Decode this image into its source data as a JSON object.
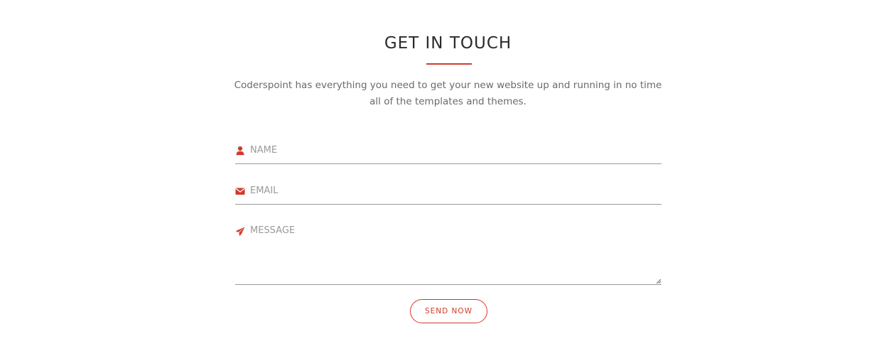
{
  "contact": {
    "title": "GET IN TOUCH",
    "intro": "Coderspoint has everything you need to get your new website up and running in no time all of the templates and themes.",
    "accent_color": "#d33a2c"
  },
  "form": {
    "name": {
      "placeholder": "NAME",
      "value": "",
      "icon": "user-icon"
    },
    "email": {
      "placeholder": "EMAIL",
      "value": "",
      "icon": "envelope-icon"
    },
    "message": {
      "placeholder": "MESSAGE",
      "value": "",
      "icon": "paper-plane-icon"
    },
    "submit_label": "SEND NOW"
  }
}
